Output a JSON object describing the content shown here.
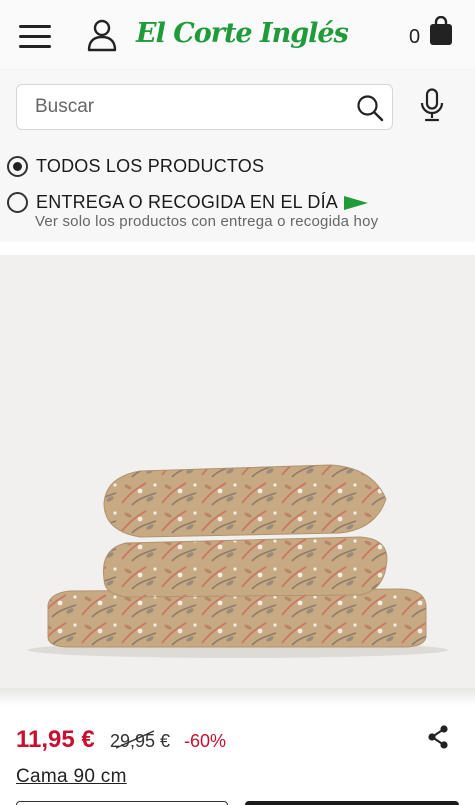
{
  "header": {
    "logo_text": "El Corte Inglés",
    "cart_count": "0"
  },
  "search": {
    "placeholder": "Buscar"
  },
  "filters": {
    "all_products_label": "TODOS LOS PRODUCTOS",
    "same_day_label": "ENTREGA O RECOGIDA EN EL DÍA",
    "same_day_sublabel": "Ver solo los productos con entrega o recogida hoy",
    "selected": "all"
  },
  "product": {
    "price_now": "11,95 €",
    "price_old": "29,95 €",
    "discount": "-60%",
    "size_option": "Cama 90 cm"
  },
  "colors": {
    "brand_green": "#1f9b3a",
    "price_red": "#c8102e"
  }
}
